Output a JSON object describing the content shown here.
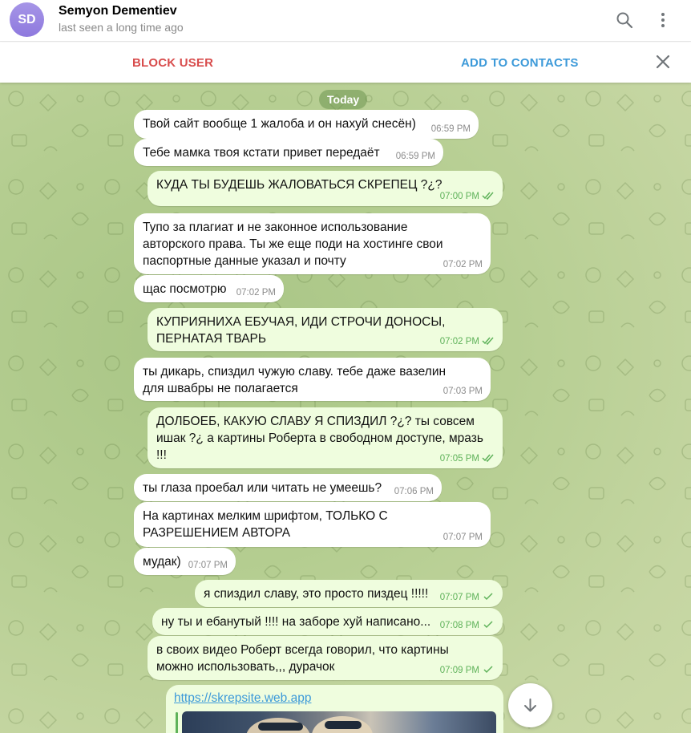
{
  "header": {
    "avatar_initials": "SD",
    "name": "Semyon Dementiev",
    "status": "last seen a long time ago",
    "icons": [
      "search-icon",
      "more-vertical-icon"
    ]
  },
  "actions": {
    "block": "BLOCK USER",
    "add": "ADD TO CONTACTS",
    "close_icon": "close-icon"
  },
  "chat": {
    "date": "Today",
    "messages": [
      {
        "dir": "in",
        "text": "Твой сайт вообще 1 жалоба и он нахуй снесён)",
        "time": "06:59 PM"
      },
      {
        "dir": "in",
        "text": "Тебе мамка твоя кстати привет передаёт",
        "time": "06:59 PM"
      },
      {
        "dir": "out",
        "text": "КУДА ТЫ БУДЕШЬ ЖАЛОВАТЬСЯ СКРЕПЕЦ ?¿?",
        "time": "07:00 PM"
      },
      {
        "dir": "in",
        "text": "Тупо за плагиат и не законное использование\nавторского права. Ты же еще поди на хостинге свои\nпаспортные данные указал и почту",
        "time": "07:02 PM"
      },
      {
        "dir": "in",
        "text": "щас посмотрю",
        "time": "07:02 PM"
      },
      {
        "dir": "out",
        "text": "КУПРИЯНИХА ЕБУЧАЯ, ИДИ СТРОЧИ ДОНОСЫ,\nПЕРНАТАЯ ТВАРЬ",
        "time": "07:02 PM"
      },
      {
        "dir": "in",
        "text": "ты дикарь, спиздил чужую славу. тебе даже вазелин\nдля швабры не полагается",
        "time": "07:03 PM"
      },
      {
        "dir": "out",
        "text": "ДОЛБОЕБ, КАКУЮ СЛАВУ Я СПИЗДИЛ ?¿? ты совсем\nишак ?¿ а картины Роберта в свободном доступе, мразь\n!!!",
        "time": "07:05 PM"
      },
      {
        "dir": "in",
        "text": "ты глаза проебал или читать не умеешь?",
        "time": "07:06 PM"
      },
      {
        "dir": "in",
        "text": "На картинах мелким шрифтом, ТОЛЬКО С\nРАЗРЕШЕНИЕМ АВТОРА",
        "time": "07:07 PM"
      },
      {
        "dir": "in",
        "text": "мудак)",
        "time": "07:07 PM"
      },
      {
        "dir": "out",
        "text": "я спиздил славу, это просто пиздец !!!!!",
        "time": "07:07 PM"
      },
      {
        "dir": "out",
        "text": "ну ты и ебанутый !!!! на заборе хуй написано...",
        "time": "07:08 PM"
      },
      {
        "dir": "out",
        "text": "в своих видео Роберт всегда говорил, что картины\nможно использовать,,, дурачок",
        "time": "07:09 PM"
      }
    ],
    "link": {
      "url": "https://skrepsite.web.app"
    }
  },
  "colors": {
    "outgoing_bubble": "#effdde",
    "incoming_bubble": "#ffffff",
    "accent_blue": "#3d9ad9",
    "danger_red": "#d84c4c",
    "read_green": "#5fb25a"
  }
}
